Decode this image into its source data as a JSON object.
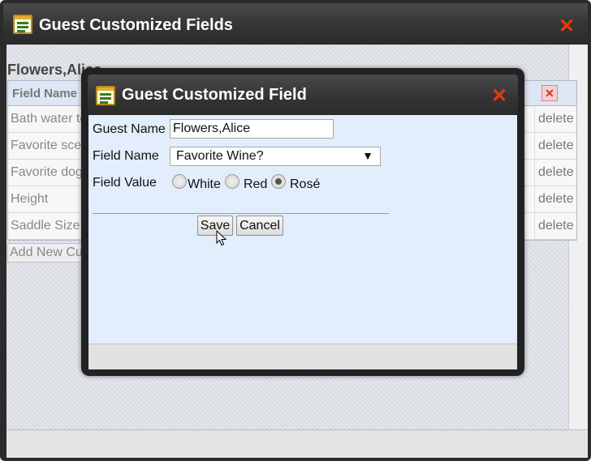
{
  "outer_window": {
    "title": "Guest Customized Fields",
    "guest_name": "Flowers,Alice",
    "table": {
      "header": "Field Name",
      "rows": [
        {
          "name": "Bath water temp",
          "action": "delete"
        },
        {
          "name": "Favorite scent",
          "action": "delete"
        },
        {
          "name": "Favorite dog",
          "action": "delete"
        },
        {
          "name": "Height",
          "action": "delete"
        },
        {
          "name": "Saddle Size",
          "action": "delete"
        }
      ],
      "add_link": "Add New Custom Field"
    }
  },
  "modal": {
    "title": "Guest Customized Field",
    "guest_name_label": "Guest Name",
    "guest_name_value": "Flowers,Alice",
    "field_name_label": "Field Name",
    "field_name_value": "Favorite Wine?",
    "field_value_label": "Field Value",
    "options": [
      {
        "label": "White",
        "checked": false
      },
      {
        "label": "Red",
        "checked": false
      },
      {
        "label": "Rosé",
        "checked": true
      }
    ],
    "save_label": "Save",
    "cancel_label": "Cancel"
  },
  "icons": {
    "close": "close-icon",
    "window": "window-icon",
    "delete_all": "delete-all-icon",
    "dropdown": "chevron-down-icon",
    "cursor": "mouse-pointer-icon"
  },
  "colors": {
    "titlebar": "#333333",
    "close": "#e33a10",
    "modal_body": "#e2eefb"
  }
}
